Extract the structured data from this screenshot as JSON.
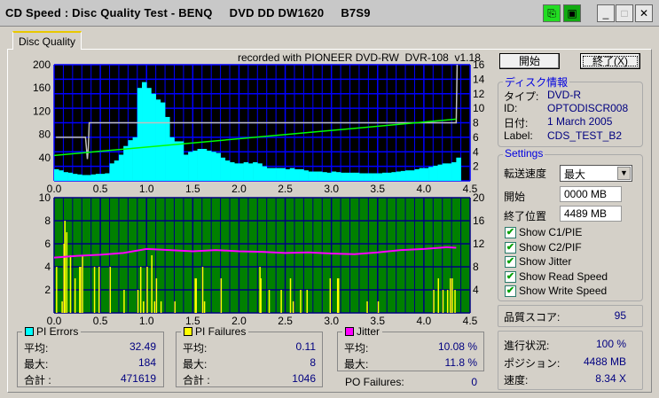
{
  "window": {
    "title": "CD Speed : Disc Quality Test - BENQ     DVD DD DW1620     B7S9"
  },
  "tabs": [
    {
      "label": "Disc Quality"
    }
  ],
  "recorded_with": "recorded with PIONEER DVD-RW  DVR-108  v1.18",
  "buttons": {
    "start": "開始",
    "exit": "終了(X)"
  },
  "disc_info": {
    "title": "ディスク情報",
    "type_label": "タイプ:",
    "type": "DVD-R",
    "id_label": "ID:",
    "id": "OPTODISCR008",
    "date_label": "日付:",
    "date": "1 March 2005",
    "label_label": "Label:",
    "label": "CDS_TEST_B2"
  },
  "settings": {
    "title": "Settings",
    "speed_label": "転送速度",
    "speed": "最大",
    "start_label": "開始",
    "start": "0000 MB",
    "end_label": "終了位置",
    "end": "4489 MB",
    "checks": [
      {
        "label": "Show C1/PIE",
        "checked": true
      },
      {
        "label": "Show C2/PIF",
        "checked": true
      },
      {
        "label": "Show Jitter",
        "checked": true
      },
      {
        "label": "Show Read Speed",
        "checked": true
      },
      {
        "label": "Show Write Speed",
        "checked": true
      }
    ]
  },
  "quality": {
    "label": "品質スコア:",
    "value": "95"
  },
  "progress": {
    "progress_label": "進行状況:",
    "progress": "100 %",
    "position_label": "ポジション:",
    "position": "4488 MB",
    "speed_label": "速度:",
    "speed": "8.34 X"
  },
  "pi_errors": {
    "title": "PI Errors",
    "color": "#00ffff",
    "avg_label": "平均:",
    "avg": "32.49",
    "max_label": "最大:",
    "max": "184",
    "total_label": "合計 :",
    "total": "471619"
  },
  "pi_failures": {
    "title": "PI Failures",
    "color": "#ffff00",
    "avg_label": "平均:",
    "avg": "0.11",
    "max_label": "最大:",
    "max": "8",
    "total_label": "合計 :",
    "total": "1046"
  },
  "jitter": {
    "title": "Jitter",
    "color": "#ff00ff",
    "avg_label": "平均:",
    "avg": "10.08 %",
    "max_label": "最大:",
    "max": "11.8 %"
  },
  "po_failures": {
    "label": "PO Failures:",
    "value": "0"
  },
  "chart_data": [
    {
      "type": "bar",
      "xlim": [
        0,
        4.5
      ],
      "ylim": [
        0,
        200
      ],
      "y2lim": [
        0,
        16
      ],
      "xticks": [
        "0.0",
        "0.5",
        "1.0",
        "1.5",
        "2.0",
        "2.5",
        "3.0",
        "3.5",
        "4.0",
        "4.5"
      ],
      "yticks": [
        "40",
        "80",
        "120",
        "160",
        "200"
      ],
      "y2ticks": [
        "2",
        "4",
        "6",
        "8",
        "10",
        "12",
        "14",
        "16"
      ],
      "background": "#000000",
      "grid": "#0000ff",
      "pie": {
        "color": "#00ffff",
        "x_start": 0,
        "x_step": 0.05,
        "values": [
          20,
          18,
          15,
          14,
          12,
          11,
          10,
          10,
          11,
          12,
          12,
          13,
          30,
          35,
          45,
          60,
          70,
          75,
          160,
          170,
          160,
          150,
          140,
          135,
          110,
          75,
          68,
          68,
          45,
          50,
          52,
          55,
          55,
          52,
          50,
          48,
          40,
          35,
          32,
          30,
          30,
          32,
          30,
          32,
          30,
          25,
          22,
          22,
          22,
          22,
          20,
          22,
          20,
          20,
          18,
          16,
          16,
          16,
          15,
          14,
          16,
          15,
          14,
          14,
          14,
          14,
          13,
          13,
          13,
          13,
          13,
          14,
          14,
          15,
          16,
          17,
          18,
          18,
          20,
          22,
          22,
          24,
          26,
          28,
          30,
          30,
          32,
          40
        ]
      },
      "read_speed": {
        "color": "#00ff00",
        "x": [
          0,
          4.35
        ],
        "y": [
          3.5,
          8.5
        ]
      },
      "write_speed": {
        "color": "#c0c0c0",
        "x": [
          0.02,
          0.34,
          0.36,
          0.37,
          0.38,
          4.35,
          4.36
        ],
        "y": [
          6,
          6,
          3,
          4.5,
          8,
          8,
          16
        ]
      }
    },
    {
      "type": "bar",
      "xlim": [
        0,
        4.5
      ],
      "ylim": [
        0,
        10
      ],
      "y2lim": [
        0,
        20
      ],
      "xticks": [
        "0.0",
        "0.5",
        "1.0",
        "1.5",
        "2.0",
        "2.5",
        "3.0",
        "3.5",
        "4.0",
        "4.5"
      ],
      "yticks": [
        "2",
        "4",
        "6",
        "8",
        "10"
      ],
      "y2ticks": [
        "4",
        "8",
        "12",
        "16",
        "20"
      ],
      "background": "#008000",
      "grid": "#000080",
      "pif": {
        "color": "#ffff00",
        "x": [
          0.02,
          0.08,
          0.1,
          0.11,
          0.13,
          0.17,
          0.22,
          0.27,
          0.28,
          0.3,
          0.43,
          0.48,
          0.6,
          0.75,
          0.9,
          0.93,
          0.96,
          1.0,
          1.05,
          1.08,
          1.1,
          1.15,
          1.3,
          1.52,
          1.53,
          1.6,
          1.62,
          1.8,
          2.22,
          2.23,
          2.32,
          2.45,
          2.55,
          2.58,
          2.66,
          2.73,
          2.98,
          3.06,
          3.07,
          3.38,
          3.5,
          4.1,
          4.15,
          4.2,
          4.25,
          4.28,
          4.3,
          4.33
        ],
        "y": [
          4,
          1,
          6,
          8,
          7,
          5,
          3,
          4,
          4,
          5,
          4,
          4,
          4,
          2,
          2,
          4,
          1,
          4,
          5,
          1,
          3,
          1,
          1,
          3,
          3,
          4,
          1,
          3,
          4,
          3,
          2,
          2,
          3,
          1,
          2,
          2,
          3,
          3,
          3,
          1,
          1,
          2,
          3,
          2,
          2,
          3,
          3,
          2
        ]
      },
      "jitter": {
        "color": "#ff00ff",
        "x": [
          0,
          0.25,
          0.5,
          0.75,
          1.0,
          1.25,
          1.5,
          1.75,
          2.0,
          2.25,
          2.5,
          2.75,
          3.0,
          3.25,
          3.5,
          3.75,
          4.0,
          4.25,
          4.35
        ],
        "y": [
          9.6,
          9.9,
          10.1,
          10.4,
          11.1,
          10.9,
          10.7,
          10.9,
          10.7,
          10.6,
          10.4,
          10.5,
          10.3,
          10.2,
          10.5,
          10.9,
          11.1,
          11.4,
          11.3
        ]
      }
    }
  ]
}
